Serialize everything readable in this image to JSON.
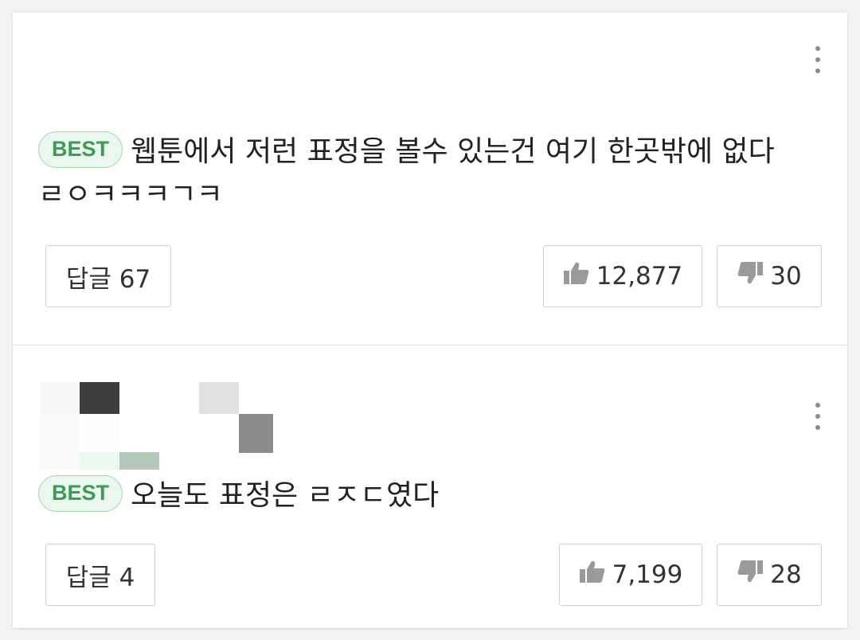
{
  "comments": [
    {
      "badge": "BEST",
      "text_line1": "웹툰에서 저런 표정을 볼수 있는건 여기 한곳밖에 없다",
      "text_line2": "ㄹㅇㅋㅋㅋㄱㅋ",
      "reply_label": "답글 67",
      "likes": "12,877",
      "dislikes": "30"
    },
    {
      "badge": "BEST",
      "text_line1": "오늘도 표정은 ㄹㅈㄷ였다",
      "reply_label": "답글 4",
      "likes": "7,199",
      "dislikes": "28"
    }
  ],
  "icons": {
    "more": "more-vertical-icon",
    "like": "thumbs-up-icon",
    "dislike": "thumbs-down-icon"
  },
  "colors": {
    "badge_text": "#3b9b57",
    "badge_bg": "#eaf7ee",
    "badge_border": "#a8d8b4",
    "icon_gray": "#9a9a9a"
  }
}
